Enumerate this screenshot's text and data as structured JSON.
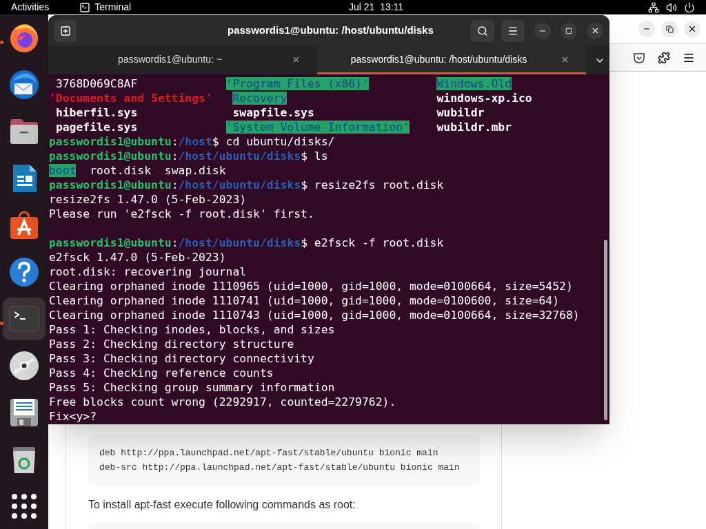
{
  "top_bar": {
    "activities": "Activities",
    "app_name": "Terminal",
    "clock": "Jul 21  13:11"
  },
  "dock": {
    "items": [
      {
        "kind": "firefox",
        "running": true,
        "selected": false
      },
      {
        "kind": "mail",
        "running": false,
        "selected": false
      },
      {
        "kind": "files",
        "running": false,
        "selected": false
      },
      {
        "kind": "writer",
        "running": false,
        "selected": false
      },
      {
        "kind": "store",
        "running": false,
        "selected": false
      },
      {
        "kind": "help",
        "running": false,
        "selected": false
      },
      {
        "kind": "terminal",
        "running": true,
        "selected": true
      },
      {
        "kind": "disc",
        "running": false,
        "selected": false
      },
      {
        "kind": "document",
        "running": false,
        "selected": false
      },
      {
        "kind": "trash",
        "running": false,
        "selected": false
      },
      {
        "kind": "apps",
        "running": false,
        "selected": false
      }
    ]
  },
  "terminal": {
    "title": "passwordis1@ubuntu: /host/ubuntu/disks",
    "tabs": [
      {
        "label": "passwordis1@ubuntu: ~",
        "selected": false
      },
      {
        "label": "passwordis1@ubuntu: /host/ubuntu/disks",
        "selected": true
      }
    ],
    "lines": [
      {
        "kind": "columns",
        "cells": [
          {
            "t": " 3768D069C8AF",
            "kind": "plain"
          },
          {
            "t": "'Program Files (x86)'",
            "kind": "hl"
          },
          {
            "t": "Windows.Old",
            "kind": "hl"
          }
        ]
      },
      {
        "kind": "columns",
        "cells": [
          {
            "t": "'Documents and Settings'",
            "kind": "red"
          },
          {
            "t": " Recovery",
            "kind": "hl"
          },
          {
            "t": "windows-xp.ico",
            "kind": "bold"
          }
        ]
      },
      {
        "kind": "columns",
        "cells": [
          {
            "t": " hiberfil.sys",
            "kind": "bold"
          },
          {
            "t": " swapfile.sys",
            "kind": "bold"
          },
          {
            "t": "wubildr",
            "kind": "bold"
          }
        ]
      },
      {
        "kind": "columns",
        "cells": [
          {
            "t": " pagefile.sys",
            "kind": "bold"
          },
          {
            "t": "'System Volume Information'",
            "kind": "hl"
          },
          {
            "t": "wubildr.mbr",
            "kind": "bold"
          }
        ]
      },
      {
        "kind": "text",
        "segs": [
          {
            "t": "passwordis1@ubuntu",
            "kind": "user"
          },
          {
            "t": ":",
            "kind": "plain"
          },
          {
            "t": "/host",
            "kind": "path"
          },
          {
            "t": "$ cd ubuntu/disks/",
            "kind": "plain"
          }
        ]
      },
      {
        "kind": "text",
        "segs": [
          {
            "t": "passwordis1@ubuntu",
            "kind": "user"
          },
          {
            "t": ":",
            "kind": "plain"
          },
          {
            "t": "/host/ubuntu/disks",
            "kind": "path"
          },
          {
            "t": "$ ls",
            "kind": "plain"
          }
        ]
      },
      {
        "kind": "text",
        "segs": [
          {
            "t": "boot",
            "kind": "hl"
          },
          {
            "t": "  root.disk  swap.disk",
            "kind": "plain"
          }
        ]
      },
      {
        "kind": "text",
        "segs": [
          {
            "t": "passwordis1@ubuntu",
            "kind": "user"
          },
          {
            "t": ":",
            "kind": "plain"
          },
          {
            "t": "/host/ubuntu/disks",
            "kind": "path"
          },
          {
            "t": "$ resize2fs root.disk",
            "kind": "plain"
          }
        ]
      },
      {
        "kind": "text",
        "segs": [
          {
            "t": "resize2fs 1.47.0 (5-Feb-2023)",
            "kind": "plain"
          }
        ]
      },
      {
        "kind": "text",
        "segs": [
          {
            "t": "Please run 'e2fsck -f root.disk' first.",
            "kind": "plain"
          }
        ]
      },
      {
        "kind": "blank"
      },
      {
        "kind": "text",
        "segs": [
          {
            "t": "passwordis1@ubuntu",
            "kind": "user"
          },
          {
            "t": ":",
            "kind": "plain"
          },
          {
            "t": "/host/ubuntu/disks",
            "kind": "path"
          },
          {
            "t": "$ e2fsck -f root.disk",
            "kind": "plain"
          }
        ]
      },
      {
        "kind": "text",
        "segs": [
          {
            "t": "e2fsck 1.47.0 (5-Feb-2023)",
            "kind": "plain"
          }
        ]
      },
      {
        "kind": "text",
        "segs": [
          {
            "t": "root.disk: recovering journal",
            "kind": "plain"
          }
        ]
      },
      {
        "kind": "text",
        "segs": [
          {
            "t": "Clearing orphaned inode 1110965 (uid=1000, gid=1000, mode=0100664, size=5452)",
            "kind": "plain"
          }
        ]
      },
      {
        "kind": "text",
        "segs": [
          {
            "t": "Clearing orphaned inode 1110741 (uid=1000, gid=1000, mode=0100600, size=64)",
            "kind": "plain"
          }
        ]
      },
      {
        "kind": "text",
        "segs": [
          {
            "t": "Clearing orphaned inode 1110743 (uid=1000, gid=1000, mode=0100664, size=32768)",
            "kind": "plain"
          }
        ]
      },
      {
        "kind": "text",
        "segs": [
          {
            "t": "Pass 1: Checking inodes, blocks, and sizes",
            "kind": "plain"
          }
        ]
      },
      {
        "kind": "text",
        "segs": [
          {
            "t": "Pass 2: Checking directory structure",
            "kind": "plain"
          }
        ]
      },
      {
        "kind": "text",
        "segs": [
          {
            "t": "Pass 3: Checking directory connectivity",
            "kind": "plain"
          }
        ]
      },
      {
        "kind": "text",
        "segs": [
          {
            "t": "Pass 4: Checking reference counts",
            "kind": "plain"
          }
        ]
      },
      {
        "kind": "text",
        "segs": [
          {
            "t": "Pass 5: Checking group summary information",
            "kind": "plain"
          }
        ]
      },
      {
        "kind": "text",
        "segs": [
          {
            "t": "Free blocks count wrong (2292917, counted=2279762).",
            "kind": "plain"
          }
        ]
      },
      {
        "kind": "text",
        "segs": [
          {
            "t": "Fix<y>?",
            "kind": "plain"
          }
        ]
      }
    ]
  },
  "browser": {
    "code_lines": [
      "deb http://ppa.launchpad.net/apt-fast/stable/ubuntu bionic main",
      "deb-src http://ppa.launchpad.net/apt-fast/stable/ubuntu bionic main"
    ],
    "paragraph": "To install apt-fast execute following commands as root:"
  }
}
